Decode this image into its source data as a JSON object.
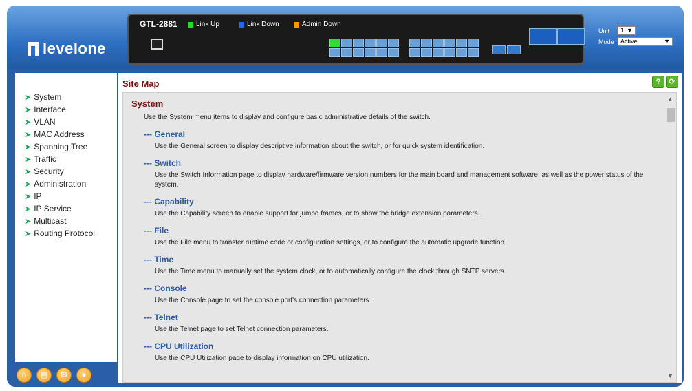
{
  "brand": {
    "name": "levelone"
  },
  "device": {
    "model": "GTL-2881",
    "legend": [
      {
        "label": "Link Up",
        "color": "#22dd22"
      },
      {
        "label": "Link Down",
        "color": "#2266ee"
      },
      {
        "label": "Admin Down",
        "color": "#ff9900"
      }
    ]
  },
  "unit": {
    "label": "Unit",
    "value": "1"
  },
  "mode": {
    "label": "Mode",
    "value": "Active"
  },
  "sidebar": {
    "items": [
      {
        "label": "System"
      },
      {
        "label": "Interface"
      },
      {
        "label": "VLAN"
      },
      {
        "label": "MAC Address"
      },
      {
        "label": "Spanning Tree"
      },
      {
        "label": "Traffic"
      },
      {
        "label": "Security"
      },
      {
        "label": "Administration"
      },
      {
        "label": "IP"
      },
      {
        "label": "IP Service"
      },
      {
        "label": "Multicast"
      },
      {
        "label": "Routing Protocol"
      }
    ]
  },
  "toolbar": {
    "help": "?",
    "refresh": "⟳"
  },
  "main": {
    "title": "Site Map",
    "section": {
      "title": "System",
      "desc": "Use the System menu items to display and configure basic administrative details of the switch.",
      "items": [
        {
          "title": "--- General",
          "desc": "Use the General screen to display descriptive information about the switch, or for quick system identification."
        },
        {
          "title": "--- Switch",
          "desc": "Use the Switch Information page to display hardware/firmware version numbers for the main board and management software, as well as the power status of the system."
        },
        {
          "title": "--- Capability",
          "desc": "Use the Capability screen to enable support for jumbo frames, or to show the bridge extension parameters."
        },
        {
          "title": "--- File",
          "desc": "Use the File menu to transfer runtime code or configuration settings, or to configure the automatic upgrade function."
        },
        {
          "title": "--- Time",
          "desc": "Use the Time menu to manually set the system clock, or to automatically configure the clock through SNTP servers."
        },
        {
          "title": "--- Console",
          "desc": "Use the Console page to set the console port's connection parameters."
        },
        {
          "title": "--- Telnet",
          "desc": "Use the Telnet page to set Telnet connection parameters."
        },
        {
          "title": "--- CPU Utilization",
          "desc": "Use the CPU Utilization page to display information on CPU utilization."
        }
      ]
    }
  }
}
